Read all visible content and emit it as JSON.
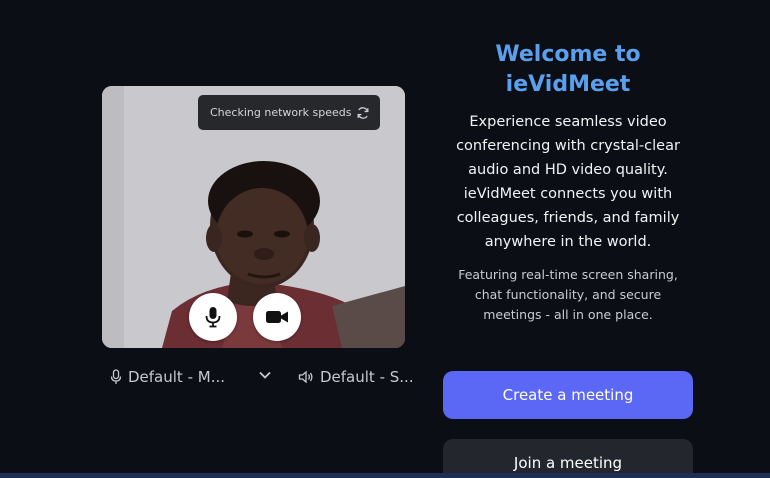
{
  "preview": {
    "network_status": "Checking network speeds",
    "icons": {
      "refresh": "refresh-icon",
      "mic": "microphone-icon",
      "camera": "video-camera-icon"
    }
  },
  "devices": {
    "microphone": "Default - M...",
    "speaker": "Default - S..."
  },
  "welcome": {
    "title": "Welcome to ieVidMeet",
    "description": "Experience seamless video conferencing with crystal-clear audio and HD video quality. ieVidMeet connects you with colleagues, friends, and family anywhere in the world.",
    "features": "Featuring real-time screen sharing, chat functionality, and secure meetings - all in one place."
  },
  "actions": {
    "create": "Create a meeting",
    "join": "Join a meeting"
  },
  "colors": {
    "background": "#0b0e14",
    "accent": "#5b67f5",
    "title": "#5aa0ee",
    "secondary_button": "#23262c"
  }
}
